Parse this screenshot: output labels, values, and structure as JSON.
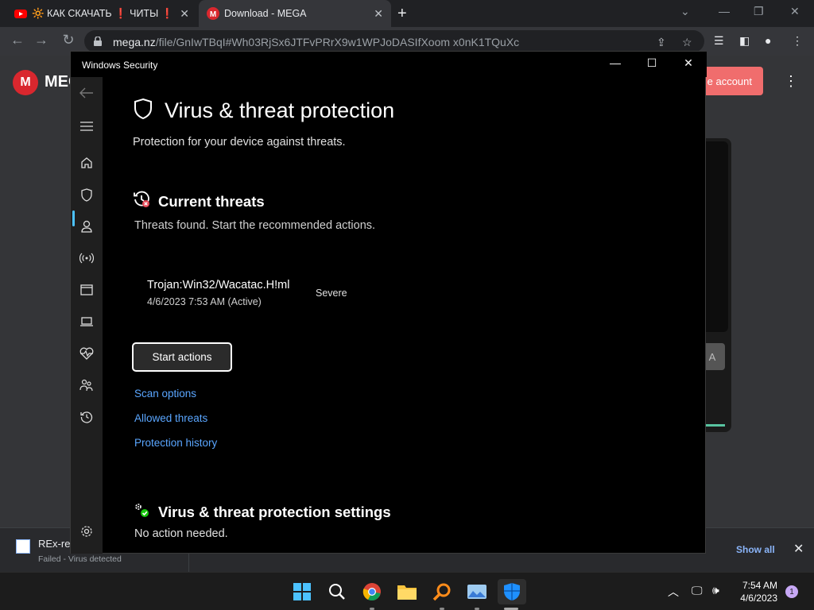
{
  "browser": {
    "tabs": [
      {
        "label": "🔆 КАК СКАЧАТЬ ❗ ЧИТЫ ❗",
        "active": false
      },
      {
        "label": "Download - MEGA",
        "active": true
      }
    ],
    "url_host": "mega.nz",
    "url_path": "/file/GnIwTBqI#Wh03RjSx6JTFvPRrX9w1WPJoDASIfXoom x0nK1TQuXc"
  },
  "mega_page": {
    "logo_letter": "M",
    "brand": "MEG",
    "create_account": "e account",
    "card_button": "A"
  },
  "downloads": {
    "file_name": "REx-re",
    "status": "Failed - Virus detected",
    "show_all": "Show all"
  },
  "security": {
    "window_title": "Windows Security",
    "page_title": "Virus & threat protection",
    "page_subtitle": "Protection for your device against threats.",
    "current_threats_heading": "Current threats",
    "current_threats_desc": "Threats found. Start the recommended actions.",
    "threat": {
      "name": "Trojan:Win32/Wacatac.H!ml",
      "time": "4/6/2023 7:53 AM (Active)",
      "severity": "Severe"
    },
    "start_actions": "Start actions",
    "links": {
      "scan_options": "Scan options",
      "allowed_threats": "Allowed threats",
      "protection_history": "Protection history"
    },
    "settings_heading": "Virus & threat protection settings",
    "settings_desc": "No action needed."
  },
  "taskbar": {
    "time": "7:54 AM",
    "date": "4/6/2023",
    "notification_count": "1"
  },
  "colors": {
    "accent_link": "#5aa6ff",
    "nav_selected": "#4cc2ff",
    "mega_red": "#d9272e"
  }
}
